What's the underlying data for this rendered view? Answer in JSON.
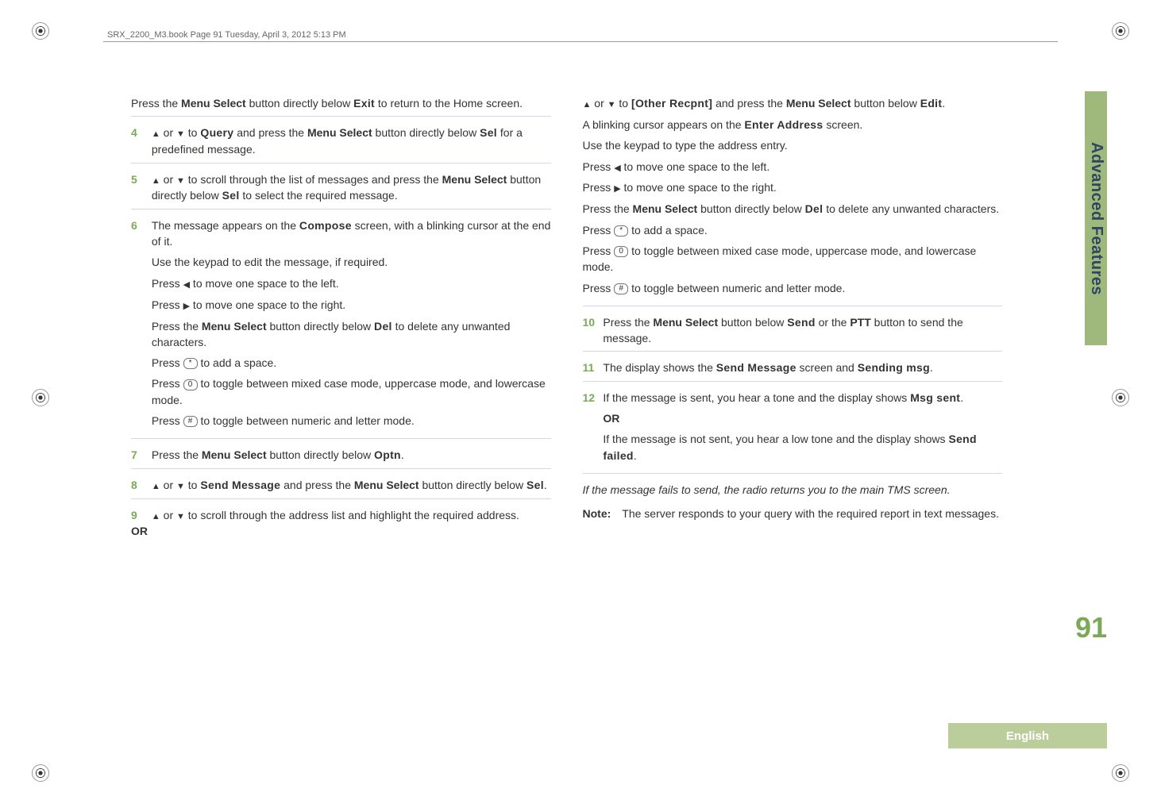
{
  "header": {
    "text": "SRX_2200_M3.book  Page 91  Tuesday, April 3, 2012  5:13 PM"
  },
  "side_tab": "Advanced Features",
  "page_number": "91",
  "english": "English",
  "labels": {
    "menu_select": "Menu Select",
    "ptt": "PTT",
    "or_word": "OR",
    "note": "Note:",
    "or_sep": " or ",
    "to": " to "
  },
  "ui": {
    "exit": "Exit",
    "query": "Query",
    "sel": "Sel",
    "compose": "Compose",
    "del": "Del",
    "optn": "Optn",
    "send_message": "Send Message",
    "other_recpnt": "[Other Recpnt]",
    "edit": "Edit",
    "enter_address": "Enter Address",
    "send": "Send",
    "send_message_screen": "Send Message",
    "sending_msg": "Sending msg",
    "msg_sent": "Msg sent",
    "send_failed": "Send failed"
  },
  "keys": {
    "star": "*",
    "zero": "0",
    "hash": "#"
  },
  "left": {
    "pre": [
      "Press the ",
      " button directly below ",
      " to return to the Home screen."
    ],
    "s4": [
      " and press the ",
      " button directly below ",
      " for a predefined message."
    ],
    "s5": [
      " to scroll through the list of messages and press the ",
      " button directly below ",
      " to select the required message."
    ],
    "s6a": "The message appears on the ",
    "s6b": " screen, with a blinking cursor at the end of it.",
    "s6c": "Use the keypad to edit the message, if required.",
    "mv_left": [
      "Press ",
      " to move one space to the left."
    ],
    "mv_right": [
      "Press ",
      " to move one space to the right."
    ],
    "del": [
      "Press the ",
      " button directly below ",
      " to delete any unwanted characters."
    ],
    "space": [
      "Press ",
      " to add a space."
    ],
    "zero": [
      "Press ",
      " to toggle between mixed case mode, uppercase mode, and lowercase mode."
    ],
    "hash": [
      "Press ",
      " to toggle between numeric and letter mode."
    ],
    "s7": [
      "Press the ",
      " button directly below ",
      "."
    ],
    "s8": [
      " and press the ",
      " button directly below ",
      "."
    ],
    "s9": [
      " to scroll through the address list and highlight the required address."
    ]
  },
  "right": {
    "other": [
      " and press the ",
      " button below ",
      "."
    ],
    "blink": [
      "A blinking cursor appears on the ",
      " screen."
    ],
    "keypad": "Use the keypad to type the address entry.",
    "s10": [
      "Press the ",
      " button below ",
      " or the ",
      " button to send the message."
    ],
    "s11": [
      "The display shows the ",
      " screen and ",
      "."
    ],
    "s12a": [
      "If the message is sent, you hear a tone and the display shows ",
      "."
    ],
    "s12b": [
      "If the message is not sent, you hear a low tone and the display shows ",
      "."
    ],
    "fail": "If the message fails to send, the radio returns you to the main TMS screen.",
    "note_text": "The server responds to your query with the required report in text messages."
  },
  "nums": {
    "n4": "4",
    "n5": "5",
    "n6": "6",
    "n7": "7",
    "n8": "8",
    "n9": "9",
    "n10": "10",
    "n11": "11",
    "n12": "12"
  }
}
